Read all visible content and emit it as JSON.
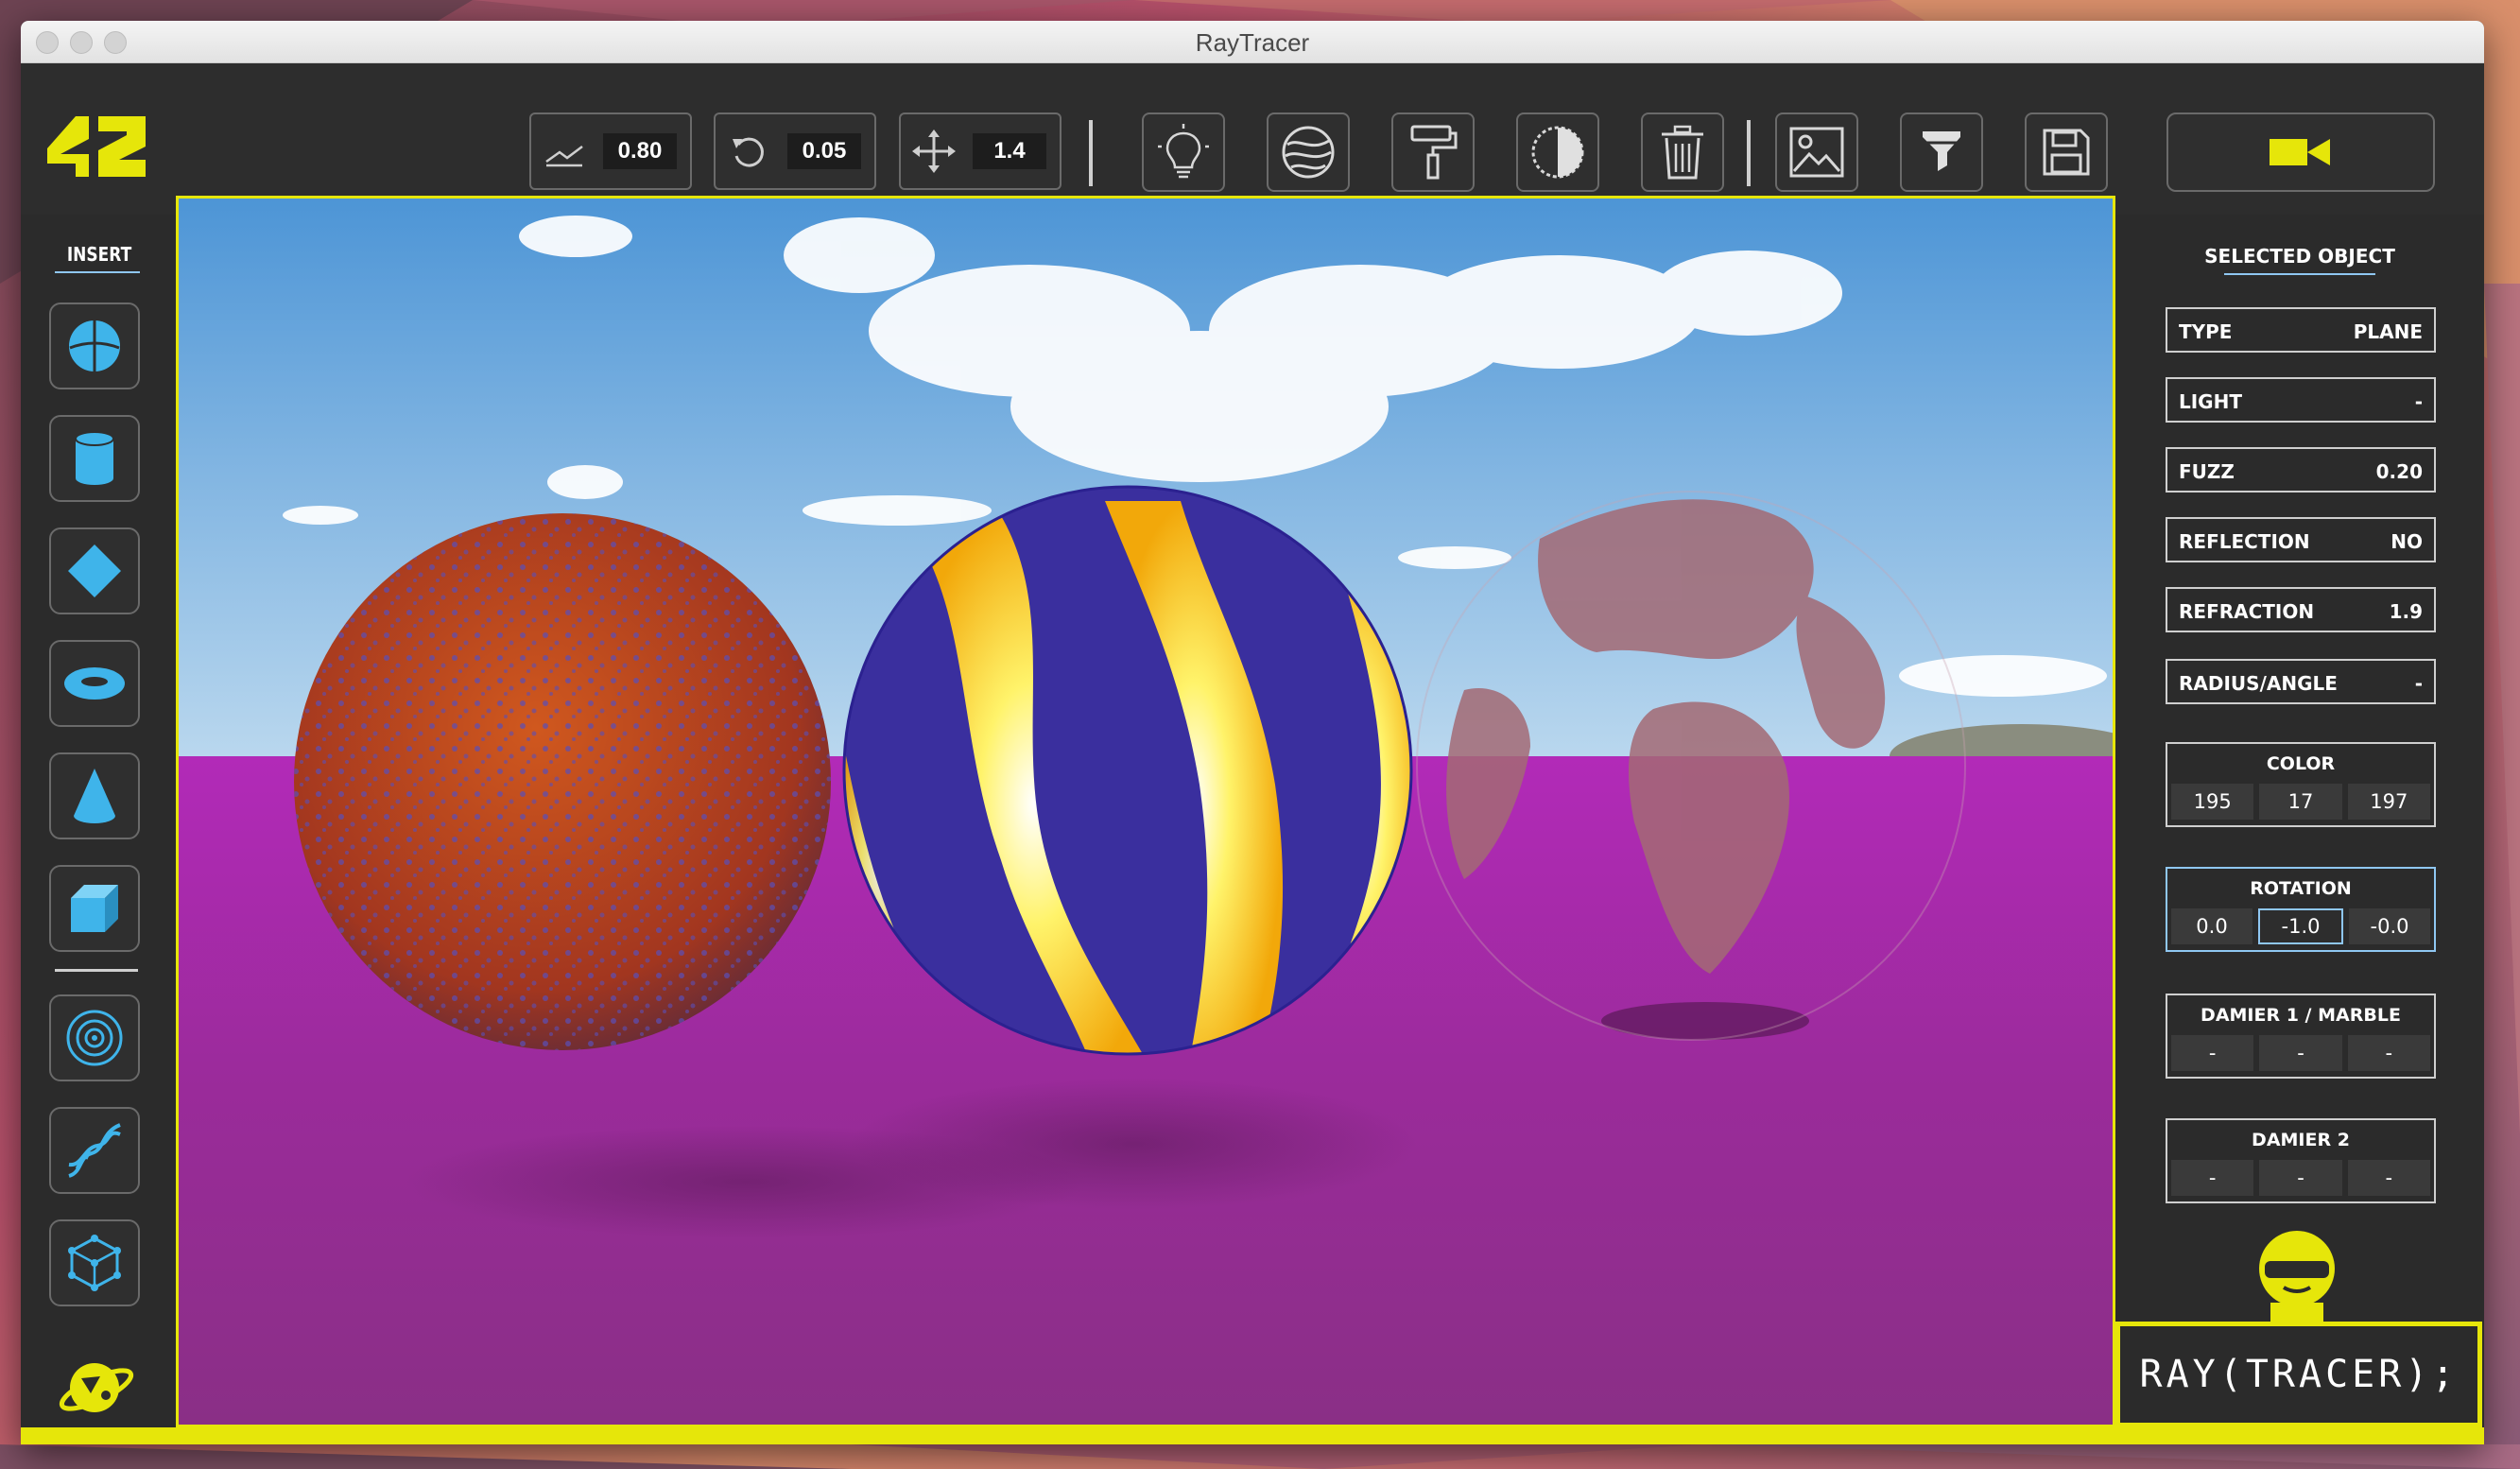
{
  "window": {
    "title": "RayTracer"
  },
  "toolbar": {
    "fuzz_step": "0.80",
    "rotate_step": "0.05",
    "move_step": "1.4"
  },
  "sidebar_left": {
    "insert_label": "INSERT"
  },
  "selected_object": {
    "heading": "SELECTED OBJECT",
    "type_label": "TYPE",
    "type_value": "PLANE",
    "light_label": "LIGHT",
    "light_value": "-",
    "fuzz_label": "FUZZ",
    "fuzz_value": "0.20",
    "reflection_label": "REFLECTION",
    "reflection_value": "NO",
    "refraction_label": "REFRACTION",
    "refraction_value": "1.9",
    "radius_label": "RADIUS/ANGLE",
    "radius_value": "-",
    "color": {
      "label": "COLOR",
      "r": "195",
      "g": "17",
      "b": "197"
    },
    "rotation": {
      "label": "ROTATION",
      "x": "0.0",
      "y": "-1.0",
      "z": "-0.0"
    },
    "damier1": {
      "label": "DAMIER 1 / MARBLE",
      "a": "-",
      "b": "-",
      "c": "-"
    },
    "damier2": {
      "label": "DAMIER 2",
      "a": "-",
      "b": "-",
      "c": "-"
    }
  },
  "brand": {
    "text": "RAY(TRACER);"
  },
  "colors": {
    "accent": "#e6e60a",
    "icon_blue": "#3fb4ea",
    "panel": "#2b2b2b",
    "selection": "#8fc7f2"
  }
}
